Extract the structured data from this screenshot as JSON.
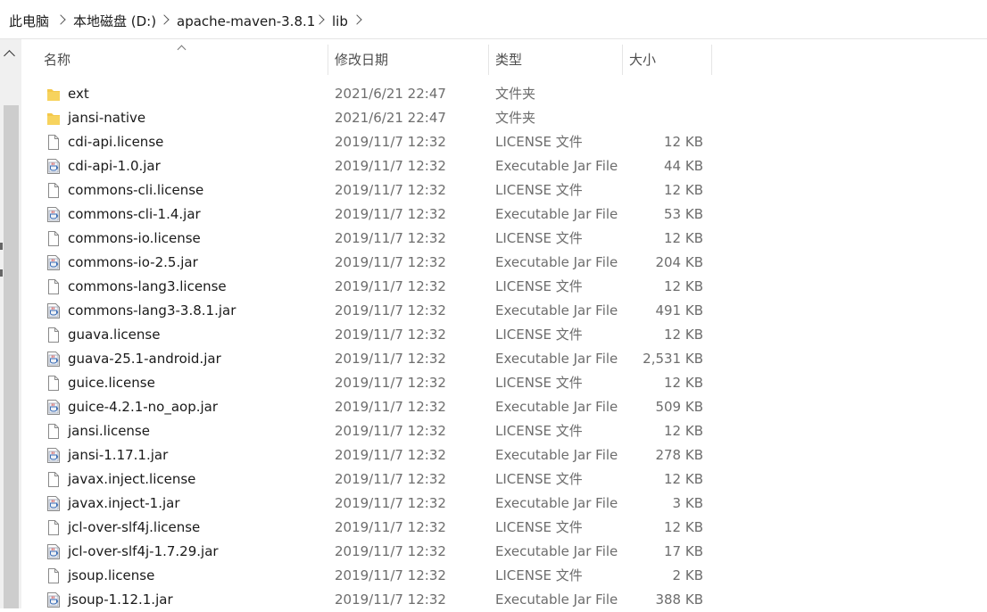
{
  "breadcrumb": {
    "items": [
      "此电脑",
      "本地磁盘 (D:)",
      "apache-maven-3.8.1",
      "lib"
    ]
  },
  "columns": {
    "name": "名称",
    "date": "修改日期",
    "type": "类型",
    "size": "大小"
  },
  "files": [
    {
      "name": "ext",
      "date": "2021/6/21 22:47",
      "type": "文件夹",
      "size": "",
      "icon": "folder-icon"
    },
    {
      "name": "jansi-native",
      "date": "2021/6/21 22:47",
      "type": "文件夹",
      "size": "",
      "icon": "folder-icon"
    },
    {
      "name": "cdi-api.license",
      "date": "2019/11/7 12:32",
      "type": "LICENSE 文件",
      "size": "12 KB",
      "icon": "file-icon"
    },
    {
      "name": "cdi-api-1.0.jar",
      "date": "2019/11/7 12:32",
      "type": "Executable Jar File",
      "size": "44 KB",
      "icon": "jar-icon"
    },
    {
      "name": "commons-cli.license",
      "date": "2019/11/7 12:32",
      "type": "LICENSE 文件",
      "size": "12 KB",
      "icon": "file-icon"
    },
    {
      "name": "commons-cli-1.4.jar",
      "date": "2019/11/7 12:32",
      "type": "Executable Jar File",
      "size": "53 KB",
      "icon": "jar-icon"
    },
    {
      "name": "commons-io.license",
      "date": "2019/11/7 12:32",
      "type": "LICENSE 文件",
      "size": "12 KB",
      "icon": "file-icon"
    },
    {
      "name": "commons-io-2.5.jar",
      "date": "2019/11/7 12:32",
      "type": "Executable Jar File",
      "size": "204 KB",
      "icon": "jar-icon"
    },
    {
      "name": "commons-lang3.license",
      "date": "2019/11/7 12:32",
      "type": "LICENSE 文件",
      "size": "12 KB",
      "icon": "file-icon"
    },
    {
      "name": "commons-lang3-3.8.1.jar",
      "date": "2019/11/7 12:32",
      "type": "Executable Jar File",
      "size": "491 KB",
      "icon": "jar-icon"
    },
    {
      "name": "guava.license",
      "date": "2019/11/7 12:32",
      "type": "LICENSE 文件",
      "size": "12 KB",
      "icon": "file-icon"
    },
    {
      "name": "guava-25.1-android.jar",
      "date": "2019/11/7 12:32",
      "type": "Executable Jar File",
      "size": "2,531 KB",
      "icon": "jar-icon"
    },
    {
      "name": "guice.license",
      "date": "2019/11/7 12:32",
      "type": "LICENSE 文件",
      "size": "12 KB",
      "icon": "file-icon"
    },
    {
      "name": "guice-4.2.1-no_aop.jar",
      "date": "2019/11/7 12:32",
      "type": "Executable Jar File",
      "size": "509 KB",
      "icon": "jar-icon"
    },
    {
      "name": "jansi.license",
      "date": "2019/11/7 12:32",
      "type": "LICENSE 文件",
      "size": "12 KB",
      "icon": "file-icon"
    },
    {
      "name": "jansi-1.17.1.jar",
      "date": "2019/11/7 12:32",
      "type": "Executable Jar File",
      "size": "278 KB",
      "icon": "jar-icon"
    },
    {
      "name": "javax.inject.license",
      "date": "2019/11/7 12:32",
      "type": "LICENSE 文件",
      "size": "12 KB",
      "icon": "file-icon"
    },
    {
      "name": "javax.inject-1.jar",
      "date": "2019/11/7 12:32",
      "type": "Executable Jar File",
      "size": "3 KB",
      "icon": "jar-icon"
    },
    {
      "name": "jcl-over-slf4j.license",
      "date": "2019/11/7 12:32",
      "type": "LICENSE 文件",
      "size": "12 KB",
      "icon": "file-icon"
    },
    {
      "name": "jcl-over-slf4j-1.7.29.jar",
      "date": "2019/11/7 12:32",
      "type": "Executable Jar File",
      "size": "17 KB",
      "icon": "jar-icon"
    },
    {
      "name": "jsoup.license",
      "date": "2019/11/7 12:32",
      "type": "LICENSE 文件",
      "size": "2 KB",
      "icon": "file-icon"
    },
    {
      "name": "jsoup-1.12.1.jar",
      "date": "2019/11/7 12:32",
      "type": "Executable Jar File",
      "size": "388 KB",
      "icon": "jar-icon"
    }
  ],
  "colors": {
    "folder": "#f4c84a",
    "secondary_text": "#6d6d6d",
    "header_text": "#4d4d4d"
  }
}
